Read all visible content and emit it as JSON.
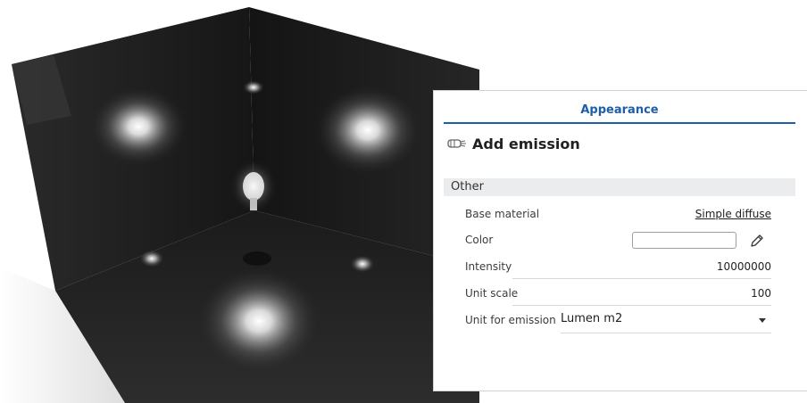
{
  "panel": {
    "tab_label": "Appearance",
    "header_title": "Add emission",
    "header_icon": "emission-icon",
    "section_label": "Other",
    "rows": {
      "base_material": {
        "label": "Base material",
        "value": "Simple diffuse"
      },
      "color": {
        "label": "Color",
        "value": "#ffffff",
        "edit_icon": "pencil-icon"
      },
      "intensity": {
        "label": "Intensity",
        "value": "10000000"
      },
      "unit_scale": {
        "label": "Unit scale",
        "value": "100"
      },
      "unit_for_emission": {
        "label": "Unit for emission",
        "value": "Lumen m2"
      }
    },
    "accent_color": "#1c5ea8"
  },
  "viewport": {
    "scene": "rendered-room-with-emissive-lights"
  }
}
